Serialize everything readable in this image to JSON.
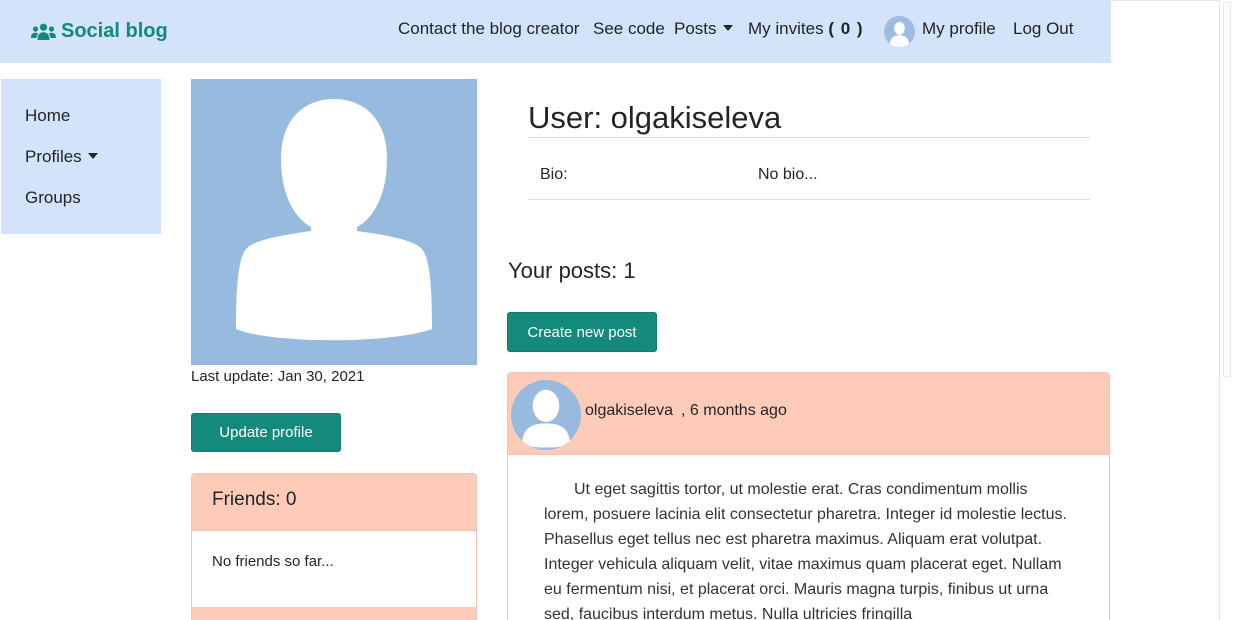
{
  "navbar": {
    "brand": "Social blog",
    "links": {
      "contact": "Contact the blog creator",
      "see_code": "See code",
      "posts": "Posts",
      "invites": "My invites",
      "invites_count": "( 0 )",
      "my_profile": "My profile",
      "log_out": "Log Out"
    }
  },
  "sidebar": {
    "items": [
      {
        "label": "Home"
      },
      {
        "label": "Profiles"
      },
      {
        "label": "Groups"
      }
    ]
  },
  "profile": {
    "last_update": "Last update: Jan 30, 2021",
    "update_button": "Update profile",
    "user_title": "User: olgakiseleva",
    "bio_label": "Bio:",
    "bio_value": "No bio..."
  },
  "friends": {
    "title": "Friends: 0",
    "empty_text": "No friends so far..."
  },
  "posts": {
    "heading": "Your posts: 1",
    "create_button": "Create new post",
    "items": [
      {
        "author": "olgakiseleva",
        "time": ", 6 months ago",
        "body": "Ut eget sagittis tortor, ut molestie erat. Cras condimentum mollis lorem, posuere lacinia elit consectetur pharetra. Integer id molestie lectus. Phasellus eget tellus nec est pharetra maximus. Aliquam erat volutpat. Integer vehicula aliquam velit, vitae maximus quam placerat eget. Nullam eu fermentum nisi, et placerat orci. Mauris magna turpis, finibus ut urna sed, faucibus interdum metus. Nulla ultricies fringilla"
      }
    ]
  },
  "icons": {
    "brand": "users-icon",
    "avatar": "user-avatar-icon"
  },
  "colors": {
    "nav_bg": "#d2e3fa",
    "brand": "#13897a",
    "button": "#148a7c",
    "card_header": "#fecbb8",
    "avatar_bg": "#97badf"
  }
}
